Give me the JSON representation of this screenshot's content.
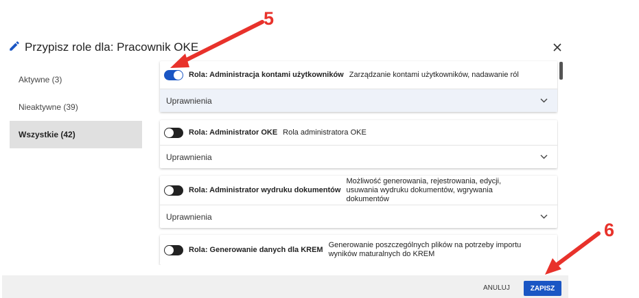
{
  "dialog": {
    "title": "Przypisz role dla: Pracownik OKE",
    "icons": {
      "edit": "pencil-icon",
      "close": "close-icon"
    }
  },
  "sidebar": {
    "items": [
      {
        "label": "Aktywne (3)",
        "active": false
      },
      {
        "label": "Nieaktywne (39)",
        "active": false
      },
      {
        "label": "Wszystkie (42)",
        "active": true
      }
    ]
  },
  "roles": [
    {
      "name": "Rola: Administracja kontami użytkowników",
      "description": "Zarządzanie kontami użytkowników, nadawanie ról",
      "enabled": true,
      "permissions_label": "Uprawnienia"
    },
    {
      "name": "Rola: Administrator OKE",
      "description": "Rola administratora OKE",
      "enabled": false,
      "permissions_label": "Uprawnienia"
    },
    {
      "name": "Rola: Administrator wydruku dokumentów",
      "description": "Możliwość generowania, rejestrowania, edycji, usuwania wydruku dokumentów, wgrywania dokumentów",
      "enabled": false,
      "permissions_label": "Uprawnienia"
    },
    {
      "name": "Rola: Generowanie danych dla KREM",
      "description": "Generowanie poszczególnych plików na potrzeby importu wyników maturalnych do KREM",
      "enabled": false
    }
  ],
  "footer": {
    "cancel_label": "ANULUJ",
    "save_label": "ZAPISZ"
  },
  "annotations": {
    "step_toggle": "5",
    "step_save": "6"
  },
  "colors": {
    "accent": "#1a56c4",
    "annotation": "#e8322b",
    "selected_tab": "#e0e0e0"
  }
}
